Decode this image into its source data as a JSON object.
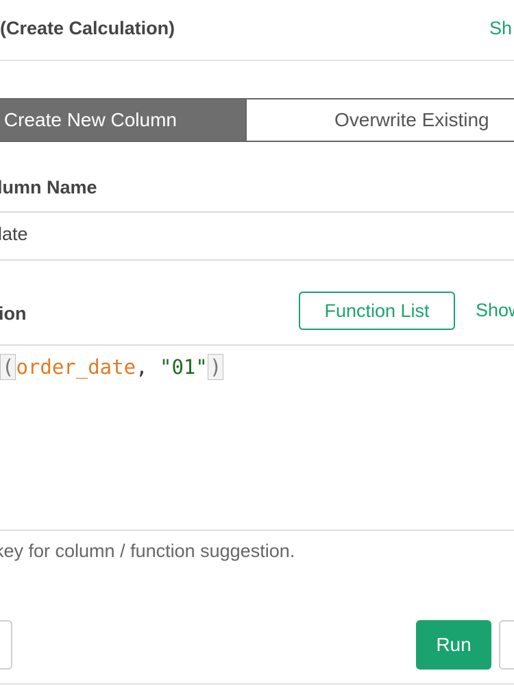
{
  "header": {
    "title": "(Create Calculation)",
    "right_link": "Sh"
  },
  "mode_toggle": {
    "active_label": "Create New Column",
    "inactive_label": "Overwrite Existing"
  },
  "column_name": {
    "label": "lumn Name",
    "value": "date"
  },
  "calculation": {
    "label": "ion",
    "function_list_label": "Function List",
    "show_link": "Show"
  },
  "editor": {
    "open_paren": "(",
    "column_token": "order_date",
    "separator": ", ",
    "string_token": "\"01\"",
    "close_paren": ")"
  },
  "hint": "key for column / function suggestion.",
  "footer": {
    "run_label": "Run"
  },
  "colors": {
    "accent": "#1aa36f",
    "segment_active_bg": "#6e6e6e",
    "column_token": "#e07b22",
    "string_token": "#1f6b1f"
  }
}
